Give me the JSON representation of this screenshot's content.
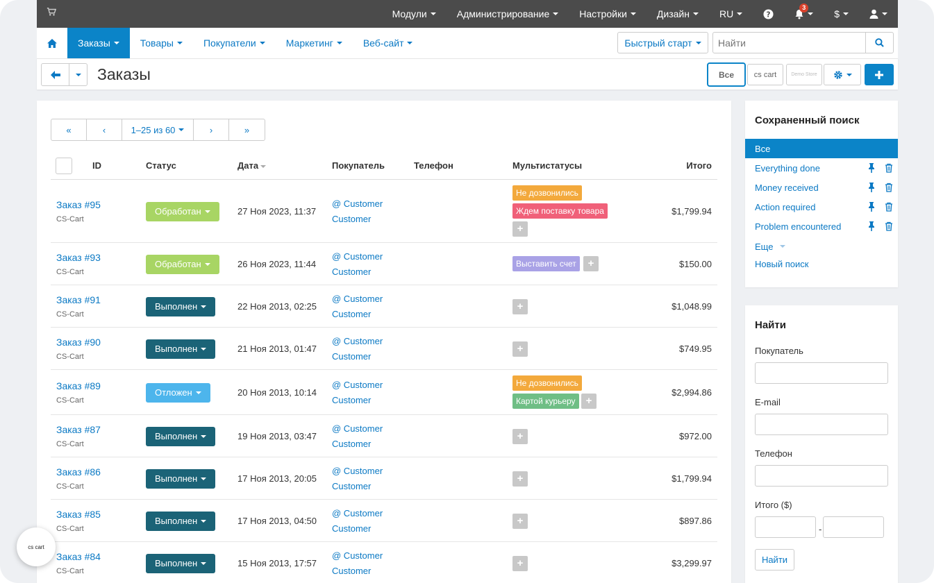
{
  "topbar": {
    "items": [
      {
        "label": "Модули",
        "dropdown": true
      },
      {
        "label": "Администрирование",
        "dropdown": true
      },
      {
        "label": "Настройки",
        "dropdown": true
      },
      {
        "label": "Дизайн",
        "dropdown": true
      },
      {
        "label": "RU",
        "dropdown": true
      }
    ],
    "notifications_count": "3",
    "currency": "$"
  },
  "navbar": {
    "menu": [
      {
        "label": "Заказы",
        "active": true
      },
      {
        "label": "Товары"
      },
      {
        "label": "Покупатели"
      },
      {
        "label": "Маркетинг"
      },
      {
        "label": "Веб-сайт"
      }
    ],
    "quick_start": "Быстрый старт",
    "search_placeholder": "Найти"
  },
  "titlebar": {
    "title": "Заказы",
    "store_all": "Все",
    "store_1": "cs cart",
    "store_2": "Demo Store"
  },
  "pager": {
    "first": "«",
    "prev": "‹",
    "range": "1–25 из 60",
    "next": "›",
    "last": "»"
  },
  "table": {
    "headers": {
      "id": "ID",
      "status": "Статус",
      "date": "Дата",
      "customer": "Покупатель",
      "phone": "Телефон",
      "multistatus": "Мультистатусы",
      "total": "Итого"
    },
    "rows": [
      {
        "id": "Заказ #95",
        "source": "CS-Cart",
        "status": "Обработан",
        "status_color": "#a8d564",
        "date": "27 Ноя 2023, 11:37",
        "customer1": "@ Customer",
        "customer2": "Customer",
        "total": "$1,799.94"
      },
      {
        "id": "Заказ #93",
        "source": "CS-Cart",
        "status": "Обработан",
        "status_color": "#a8d564",
        "date": "26 Ноя 2023, 11:44",
        "customer1": "@ Customer",
        "customer2": "Customer",
        "total": "$150.00"
      },
      {
        "id": "Заказ #91",
        "source": "CS-Cart",
        "status": "Выполнен",
        "status_color": "#1b6377",
        "date": "22 Ноя 2013, 02:25",
        "customer1": "@ Customer",
        "customer2": "Customer",
        "total": "$1,048.99"
      },
      {
        "id": "Заказ #90",
        "source": "CS-Cart",
        "status": "Выполнен",
        "status_color": "#1b6377",
        "date": "21 Ноя 2013, 01:47",
        "customer1": "@ Customer",
        "customer2": "Customer",
        "total": "$749.95"
      },
      {
        "id": "Заказ #89",
        "source": "CS-Cart",
        "status": "Отложен",
        "status_color": "#4db5ec",
        "date": "20 Ноя 2013, 10:14",
        "customer1": "@ Customer",
        "customer2": "Customer",
        "total": "$2,994.86"
      },
      {
        "id": "Заказ #87",
        "source": "CS-Cart",
        "status": "Выполнен",
        "status_color": "#1b6377",
        "date": "19 Ноя 2013, 03:47",
        "customer1": "@ Customer",
        "customer2": "Customer",
        "total": "$972.00"
      },
      {
        "id": "Заказ #86",
        "source": "CS-Cart",
        "status": "Выполнен",
        "status_color": "#1b6377",
        "date": "17 Ноя 2013, 20:05",
        "customer1": "@ Customer",
        "customer2": "Customer",
        "total": "$1,799.94"
      },
      {
        "id": "Заказ #85",
        "source": "CS-Cart",
        "status": "Выполнен",
        "status_color": "#1b6377",
        "date": "17 Ноя 2013, 04:50",
        "customer1": "@ Customer",
        "customer2": "Customer",
        "total": "$897.86"
      },
      {
        "id": "Заказ #84",
        "source": "CS-Cart",
        "status": "Выполнен",
        "status_color": "#1b6377",
        "date": "15 Ноя 2013, 17:57",
        "customer1": "@ Customer",
        "customer2": "Customer",
        "total": "$3,299.97"
      }
    ],
    "tags": {
      "row0": [
        "Не дозвонились",
        "Ждем поставку товара"
      ],
      "row1": [
        "Выставить счет"
      ],
      "row4": [
        "Не дозвонились",
        "Картой курьеру"
      ]
    },
    "tag_colors": {
      "orange": "#f3a93c",
      "pink": "#f06079",
      "purple": "#a9a2e6",
      "green": "#6fbe85"
    },
    "plus": "+"
  },
  "saved_search": {
    "title": "Сохраненный поиск",
    "items": [
      "Все",
      "Everything done",
      "Money received",
      "Action required",
      "Problem encountered"
    ],
    "more": "Еще",
    "new_search": "Новый поиск"
  },
  "find": {
    "title": "Найти",
    "customer_label": "Покупатель",
    "email_label": "E-mail",
    "phone_label": "Телефон",
    "total_label": "Итого ($)",
    "range_sep": "-",
    "button": "Найти"
  },
  "corner_badge": "cs cart"
}
